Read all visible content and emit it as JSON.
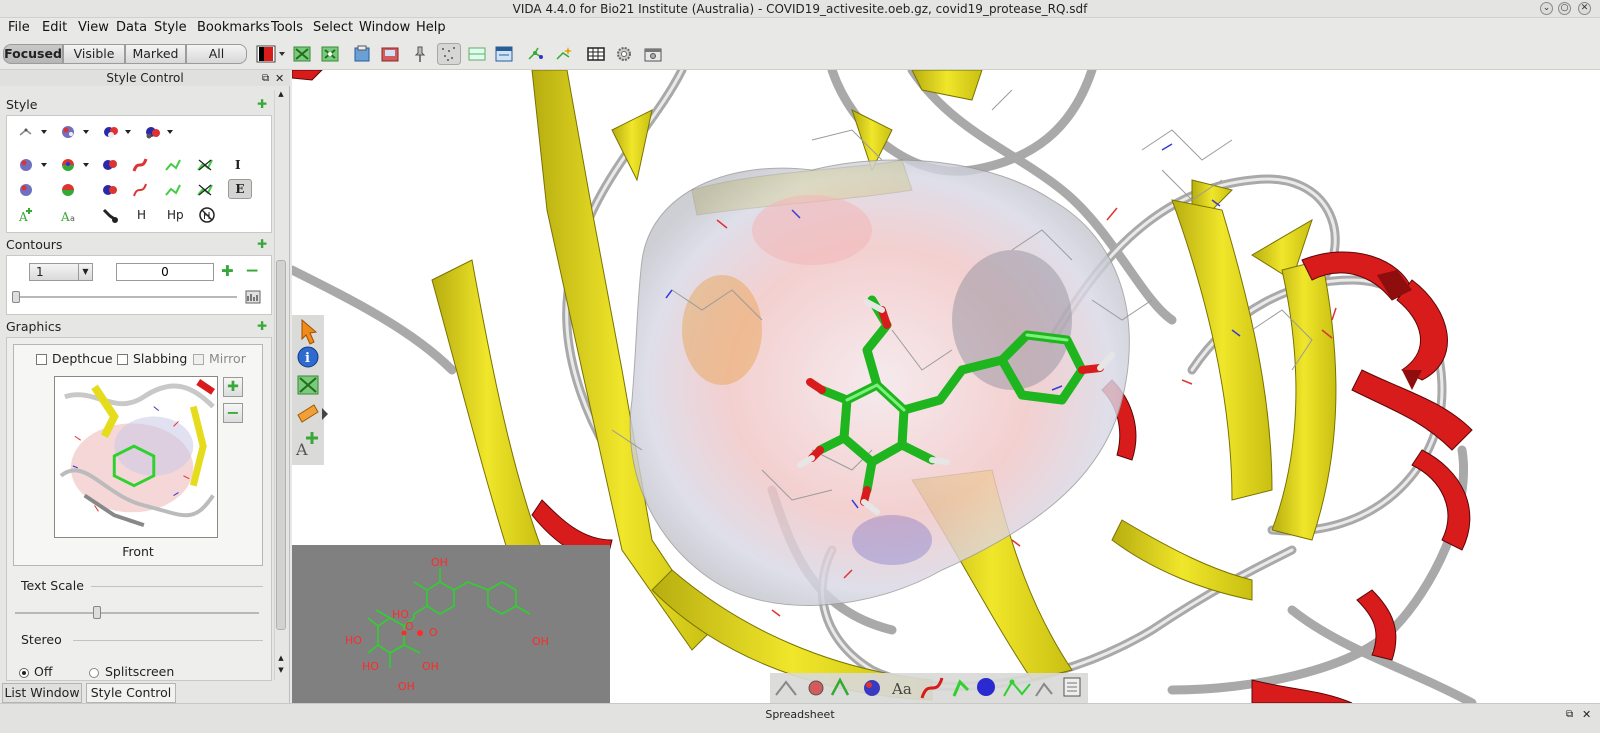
{
  "window": {
    "title": "VIDA 4.4.0 for Bio21 Institute (Australia) - COVID19_activesite.oeb.gz, covid19_protease_RQ.sdf"
  },
  "menu": [
    "File",
    "Edit",
    "View",
    "Data",
    "Style",
    "Bookmarks",
    "Tools",
    "Select",
    "Window",
    "Help"
  ],
  "toolbar": {
    "scope_buttons": [
      "Focused",
      "Visible",
      "Marked",
      "All"
    ],
    "active_scope": "Focused"
  },
  "style_control": {
    "panel_title": "Style Control",
    "style_section": "Style",
    "text_icons": [
      "I",
      "E",
      "H",
      "Hp"
    ],
    "contours_section": "Contours",
    "contour_select": "1",
    "contour_value": "0",
    "graphics_section": "Graphics",
    "depthcue_label": "Depthcue",
    "slabbing_label": "Slabbing",
    "mirror_label": "Mirror",
    "view_label": "Front",
    "text_scale_label": "Text Scale",
    "stereo_label": "Stereo",
    "stereo_off": "Off",
    "stereo_splitscreen": "Splitscreen"
  },
  "bottom_tabs": [
    "List Window",
    "Style Control"
  ],
  "active_bottom_tab": "Style Control",
  "spreadsheet_label": "Spreadsheet",
  "ligand_2d": {
    "labels": [
      "OH",
      "HO",
      "HO",
      "O",
      "O",
      "HO",
      "OH",
      "OH",
      "OH"
    ]
  },
  "colors": {
    "ribbon_yellow": "#e6dc1e",
    "helix_red": "#d81b1b",
    "ligand_green": "#2ed12e",
    "overlay_gray": "#808080",
    "accent_green": "#39a83a"
  }
}
